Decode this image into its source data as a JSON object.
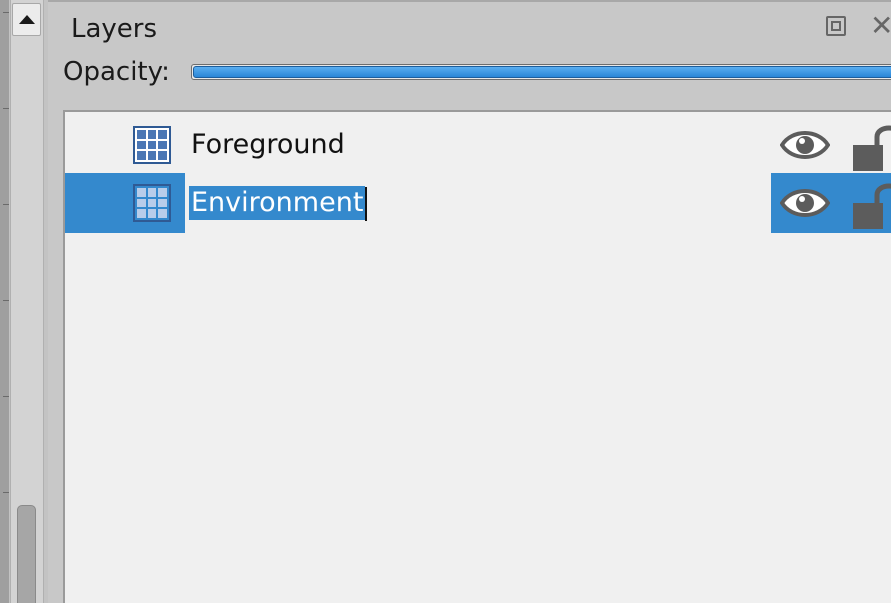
{
  "panel": {
    "title": "Layers",
    "float_icon": "float-window-icon",
    "close_icon": "close-icon",
    "close_glyph": "✕"
  },
  "opacity": {
    "label": "Opacity:",
    "value_percent": 100
  },
  "layers": [
    {
      "name": "Foreground",
      "icon": "tile-layer-icon",
      "visible": true,
      "locked": false,
      "selected": false,
      "editing": false
    },
    {
      "name": "Environment",
      "icon": "tile-layer-icon",
      "visible": true,
      "locked": false,
      "selected": true,
      "editing": true
    }
  ],
  "colors": {
    "selection": "#3489cd",
    "list_background": "#f0f0f0",
    "panel_background": "#c8c8c8",
    "icon_gray": "#606060",
    "slider_fill": "#2b86d6"
  }
}
